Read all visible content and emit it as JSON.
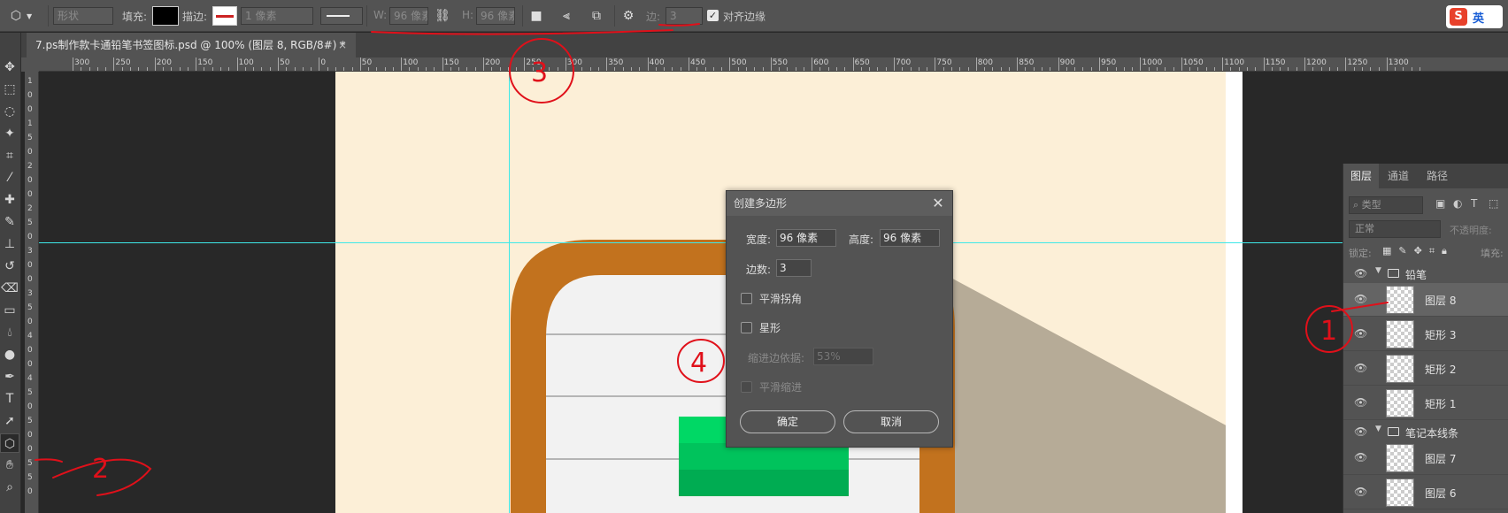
{
  "options_bar": {
    "shape_mode": "形状",
    "fill_label": "填充:",
    "stroke_label": "描边:",
    "stroke_width": "1 像素",
    "w_label": "W:",
    "w_value": "96 像素",
    "h_label": "H:",
    "h_value": "96 像素",
    "sides_label": "边:",
    "sides_value": "3",
    "align_edges_label": "对齐边缘",
    "ime_label": "英"
  },
  "document_tab": {
    "title": "7.ps制作款卡通铅笔书签图标.psd @ 100% (图层 8, RGB/8#) *",
    "close": "×"
  },
  "ruler_h": {
    "labels": [
      "300",
      "250",
      "200",
      "150",
      "100",
      "50",
      "0",
      "50",
      "100",
      "150",
      "200",
      "250",
      "300",
      "350",
      "400",
      "450",
      "500",
      "550",
      "600",
      "650",
      "700",
      "750",
      "800",
      "850",
      "900",
      "950",
      "1000",
      "1050",
      "1100",
      "1150",
      "1200",
      "1250",
      "1300"
    ]
  },
  "ruler_v": {
    "labels": [
      "1",
      "0",
      "0",
      "1",
      "5",
      "0",
      "2",
      "0",
      "0",
      "2",
      "5",
      "0",
      "3",
      "0",
      "0",
      "3",
      "5",
      "0",
      "4",
      "0",
      "0",
      "4",
      "5",
      "0",
      "5",
      "0",
      "0",
      "5",
      "5",
      "0"
    ]
  },
  "dialog": {
    "title": "创建多边形",
    "width_label": "宽度:",
    "width_value": "96 像素",
    "height_label": "高度:",
    "height_value": "96 像素",
    "sides_label": "边数:",
    "sides_value": "3",
    "smooth_corners_label": "平滑拐角",
    "star_label": "星形",
    "indent_label": "缩进边依据:",
    "indent_value": "53%",
    "smooth_indent_label": "平滑缩进",
    "ok_label": "确定",
    "cancel_label": "取消"
  },
  "layers_panel": {
    "tabs": [
      "图层",
      "通道",
      "路径"
    ],
    "filter_label": "类型",
    "blend_mode": "正常",
    "opacity_label": "不透明度:",
    "lock_label": "锁定:",
    "fill_label": "填充:",
    "groups": [
      {
        "name": "铅笔",
        "layers": [
          "图层 8",
          "矩形 3",
          "矩形 2",
          "矩形 1"
        ]
      },
      {
        "name": "笔记本线条",
        "layers": [
          "图层 7",
          "图层 6"
        ]
      }
    ]
  },
  "annotations": [
    "1",
    "2",
    "3",
    "4"
  ],
  "colors": {
    "canvas_bg": "#fcefd7",
    "pencil_orange": "#c2721e",
    "notebook_gray": "#f2f2f2",
    "green_block": "#00c060",
    "guide_cyan": "#3ee8e8",
    "annotation_red": "#e0101a"
  }
}
